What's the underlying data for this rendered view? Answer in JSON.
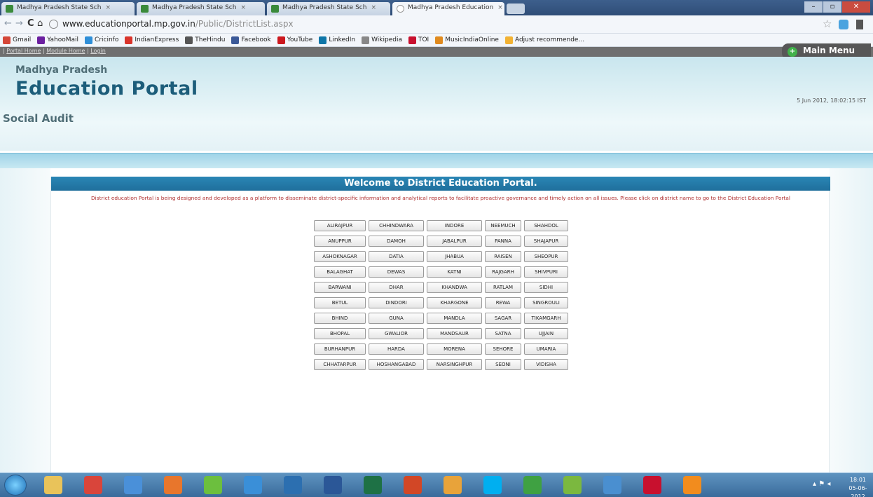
{
  "browser": {
    "tabs": [
      {
        "title": "Madhya Pradesh State Sch",
        "active": false
      },
      {
        "title": "Madhya Pradesh State Sch",
        "active": false
      },
      {
        "title": "Madhya Pradesh State Sch",
        "active": false
      },
      {
        "title": "Madhya Pradesh Education",
        "active": true
      }
    ],
    "url_host": "www.educationportal.mp.gov.in",
    "url_path": "/Public/DistrictList.aspx",
    "bookmarks": [
      {
        "label": "Gmail",
        "color": "#d44638"
      },
      {
        "label": "YahooMail",
        "color": "#6b1fa0"
      },
      {
        "label": "Cricinfo",
        "color": "#2f8fd8"
      },
      {
        "label": "IndianExpress",
        "color": "#d9342b"
      },
      {
        "label": "TheHindu",
        "color": "#555555"
      },
      {
        "label": "Facebook",
        "color": "#3b5998"
      },
      {
        "label": "YouTube",
        "color": "#cc181e"
      },
      {
        "label": "LinkedIn",
        "color": "#0e76a8"
      },
      {
        "label": "Wikipedia",
        "color": "#888888"
      },
      {
        "label": "TOI",
        "color": "#c8102e"
      },
      {
        "label": "MusicIndiaOnline",
        "color": "#e08a1e"
      },
      {
        "label": "Adjust recommende...",
        "color": "#f2b233"
      }
    ]
  },
  "page": {
    "toplinks": [
      "Portal Home",
      "Module Home",
      "Login"
    ],
    "main_menu": "Main Menu",
    "state": "Madhya Pradesh",
    "portal_title": "Education Portal",
    "module": "Social Audit",
    "datetime": "5 Jun 2012, 18:02:15 IST",
    "welcome": "Welcome to District Education Portal.",
    "description": "District education Portal is being designed and developed as a platform to disseminate district-specific information and analytical reports to facilitate proactive governance and timely action on all issues. Please click on district name to go to the District Education Portal",
    "districts": [
      "ALIRAJPUR",
      "CHHINDWARA",
      "INDORE",
      "NEEMUCH",
      "SHAHDOL",
      "ANUPPUR",
      "DAMOH",
      "JABALPUR",
      "PANNA",
      "SHAJAPUR",
      "ASHOKNAGAR",
      "DATIA",
      "JHABUA",
      "RAISEN",
      "SHEOPUR",
      "BALAGHAT",
      "DEWAS",
      "KATNI",
      "RAJGARH",
      "SHIVPURI",
      "BARWANI",
      "DHAR",
      "KHANDWA",
      "RATLAM",
      "SIDHI",
      "BETUL",
      "DINDORI",
      "KHARGONE",
      "REWA",
      "SINGROULI",
      "BHIND",
      "GUNA",
      "MANDLA",
      "SAGAR",
      "TIKAMGARH",
      "BHOPAL",
      "GWALIOR",
      "MANDSAUR",
      "SATNA",
      "UJJAIN",
      "BURHANPUR",
      "HARDA",
      "MORENA",
      "SEHORE",
      "UMARIA",
      "CHHATARPUR",
      "HOSHANGABAD",
      "NARSINGHPUR",
      "SEONI",
      "VIDISHA"
    ]
  },
  "taskbar": {
    "clock_time": "18:01",
    "clock_date": "05-06-2012",
    "apps": [
      {
        "name": "explorer-icon",
        "color": "#e9c35a"
      },
      {
        "name": "chrome-icon",
        "color": "#d9453b"
      },
      {
        "name": "network-icon",
        "color": "#4a90d9"
      },
      {
        "name": "firefox-icon",
        "color": "#e8762c"
      },
      {
        "name": "ie-alt-icon",
        "color": "#6cbf3e"
      },
      {
        "name": "internet-explorer-icon",
        "color": "#3a8fd8"
      },
      {
        "name": "media-player-icon",
        "color": "#2c6fb0"
      },
      {
        "name": "word-icon",
        "color": "#2b5797"
      },
      {
        "name": "excel-icon",
        "color": "#1e7145"
      },
      {
        "name": "powerpoint-icon",
        "color": "#d24726"
      },
      {
        "name": "outlook-icon",
        "color": "#e8a33a"
      },
      {
        "name": "skype-icon",
        "color": "#00aff0"
      },
      {
        "name": "messenger-icon",
        "color": "#3fa142"
      },
      {
        "name": "ie-green-icon",
        "color": "#7bb83f"
      },
      {
        "name": "itunes-icon",
        "color": "#4a8fd0"
      },
      {
        "name": "acrobat-icon",
        "color": "#c8102e"
      },
      {
        "name": "vlc-icon",
        "color": "#f28c1e"
      }
    ]
  }
}
